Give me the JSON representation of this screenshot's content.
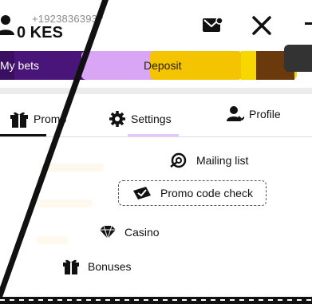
{
  "header": {
    "account_id": "+1923836393?",
    "balance": "0 KES",
    "icons": {
      "account": "account-icon",
      "mail": "mail-icon",
      "close": "close-icon"
    }
  },
  "action_bar": {
    "my_bets_label": "My bets",
    "deposit_label": "Deposit",
    "colors": {
      "my_bets": "#4a1578",
      "lilac": "#d9a6f5",
      "deposit": "#f4c400",
      "brown": "#6a3a0c"
    }
  },
  "tabs": [
    {
      "label": "Promo",
      "icon": "gift-icon"
    },
    {
      "label": "Settings",
      "icon": "gear-icon",
      "active": true
    },
    {
      "label": "Profile",
      "icon": "user-icon"
    }
  ],
  "settings_menu": [
    {
      "label": "Mailing list",
      "icon": "mailing-icon"
    },
    {
      "label": "Promo code check",
      "icon": "ticket-icon",
      "focused": true
    },
    {
      "label": "Casino",
      "icon": "diamond-icon"
    },
    {
      "label": "Bonuses",
      "icon": "gift-icon"
    }
  ]
}
